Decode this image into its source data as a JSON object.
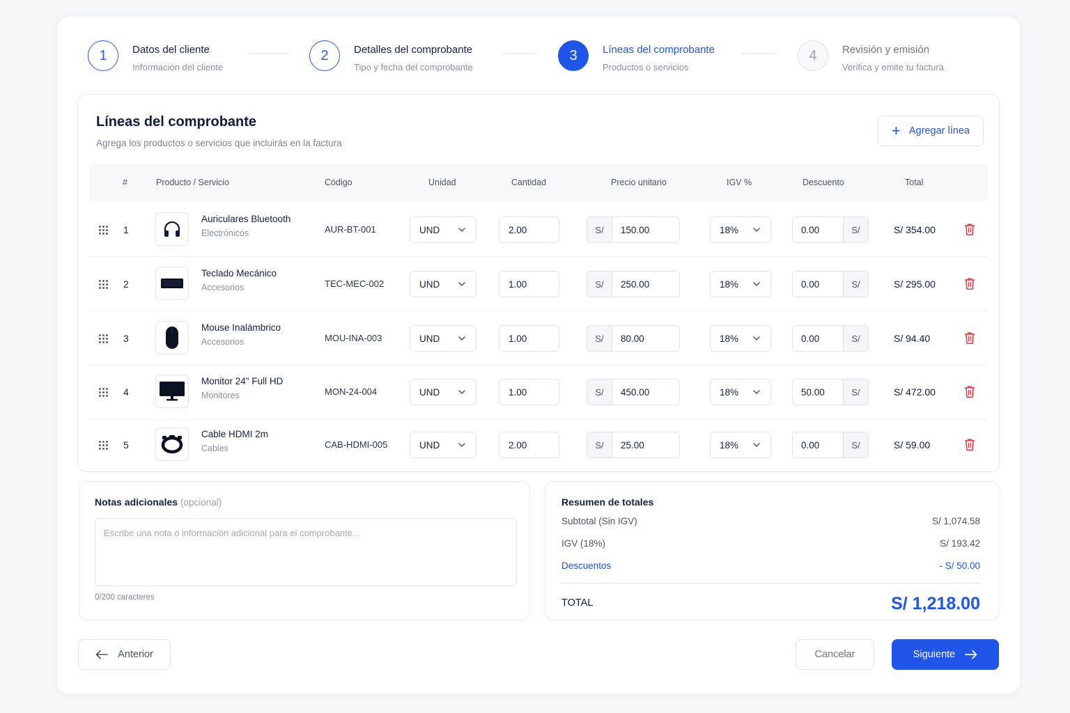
{
  "steps": [
    {
      "number": "1",
      "title": "Datos del cliente",
      "subtitle": "Información del cliente"
    },
    {
      "number": "2",
      "title": "Detalles del comprobante",
      "subtitle": "Tipo y fecha del comprobante"
    },
    {
      "number": "3",
      "title": "Líneas del comprobante",
      "subtitle": "Productos o servicios"
    },
    {
      "number": "4",
      "title": "Revisión y emisión",
      "subtitle": "Verifica y emite tu factura"
    }
  ],
  "lines_section": {
    "title": "Líneas del comprobante",
    "subtitle": "Agrega los productos o servicios que incluirás en la factura",
    "add_button": "Agregar línea"
  },
  "table": {
    "headers": [
      "#",
      "Producto / Servicio",
      "Código",
      "Unidad",
      "Cantidad",
      "Precio unitario",
      "IGV %",
      "Descuento",
      "Total"
    ],
    "currency_prefix": "S/",
    "rows": [
      {
        "num": "1",
        "icon": "headphones-icon",
        "name": "Auriculares Bluetooth",
        "category": "Electrónicos",
        "code": "AUR-BT-001",
        "unit": "UND",
        "qty": "2.00",
        "price": "150.00",
        "igv": "18%",
        "discount": "0.00",
        "total": "S/ 354.00"
      },
      {
        "num": "2",
        "icon": "keyboard-icon",
        "name": "Teclado Mecánico",
        "category": "Accesorios",
        "code": "TEC-MEC-002",
        "unit": "UND",
        "qty": "1.00",
        "price": "250.00",
        "igv": "18%",
        "discount": "0.00",
        "total": "S/ 295.00"
      },
      {
        "num": "3",
        "icon": "mouse-icon",
        "name": "Mouse Inalámbrico",
        "category": "Accesorios",
        "code": "MOU-INA-003",
        "unit": "UND",
        "qty": "1.00",
        "price": "80.00",
        "igv": "18%",
        "discount": "0.00",
        "total": "S/ 94.40"
      },
      {
        "num": "4",
        "icon": "monitor-icon",
        "name": "Monitor 24\" Full HD",
        "category": "Monitores",
        "code": "MON-24-004",
        "unit": "UND",
        "qty": "1.00",
        "price": "450.00",
        "igv": "18%",
        "discount": "50.00",
        "total": "S/ 472.00"
      },
      {
        "num": "5",
        "icon": "cable-icon",
        "name": "Cable HDMI 2m",
        "category": "Cables",
        "code": "CAB-HDMI-005",
        "unit": "UND",
        "qty": "2.00",
        "price": "25.00",
        "igv": "18%",
        "discount": "0.00",
        "total": "S/ 59.00"
      }
    ]
  },
  "notes": {
    "label": "Notas adicionales",
    "optional": "(opcional)",
    "placeholder": "Escribe una nota o información adicional para el comprobante...",
    "counter": "0/200 caracteres"
  },
  "summary": {
    "title": "Resumen de totales",
    "subtotal_label": "Subtotal (Sin IGV)",
    "subtotal_value": "S/ 1,074.58",
    "igv_label": "IGV (18%)",
    "igv_value": "S/ 193.42",
    "discount_label": "Descuentos",
    "discount_value": "- S/ 50.00",
    "total_label": "TOTAL",
    "total_value": "S/ 1,218.00"
  },
  "footer": {
    "prev": "Anterior",
    "cancel": "Cancelar",
    "next": "Siguiente"
  },
  "colors": {
    "accent": "#1f55e8",
    "danger": "#e0373f",
    "border": "#dfe3ea"
  }
}
